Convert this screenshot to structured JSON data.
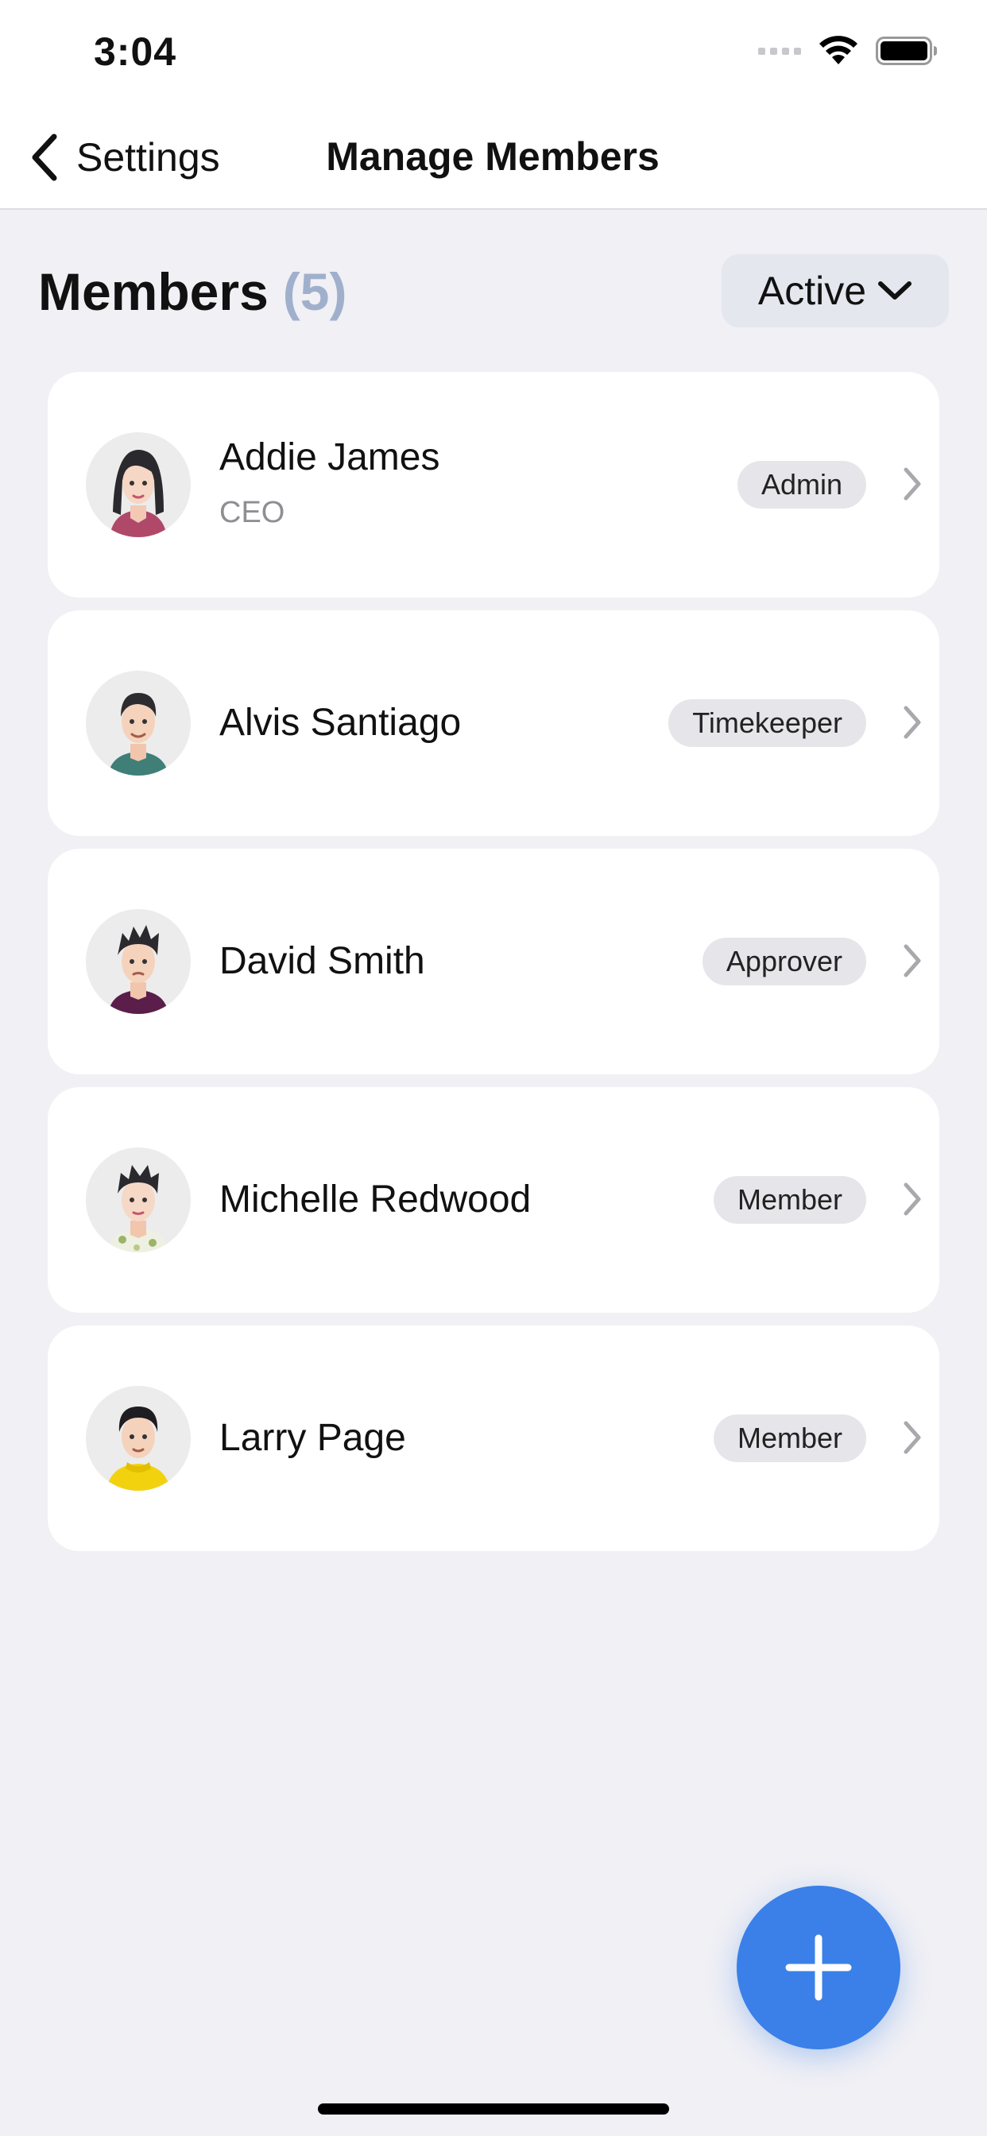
{
  "status_bar": {
    "time": "3:04"
  },
  "nav": {
    "back_label": "Settings",
    "title": "Manage Members"
  },
  "members_header": {
    "title": "Members",
    "count": "(5)"
  },
  "filter": {
    "selected": "Active"
  },
  "members": [
    {
      "name": "Addie James",
      "title": "CEO",
      "role": "Admin"
    },
    {
      "name": "Alvis Santiago",
      "title": "",
      "role": "Timekeeper"
    },
    {
      "name": "David Smith",
      "title": "",
      "role": "Approver"
    },
    {
      "name": "Michelle Redwood",
      "title": "",
      "role": "Member"
    },
    {
      "name": "Larry Page",
      "title": "",
      "role": "Member"
    }
  ],
  "colors": {
    "background": "#f0f0f5",
    "accent": "#3a80e8",
    "count": "#a0b0cc",
    "badge": "#e5e5ea",
    "filter_bg": "#e4e7ee"
  },
  "icons": {
    "back": "chevron-left-icon",
    "filter": "chevron-down-icon",
    "row": "chevron-right-icon",
    "fab": "plus-icon",
    "wifi": "wifi-icon",
    "battery": "battery-icon",
    "signal": "signal-icon"
  }
}
